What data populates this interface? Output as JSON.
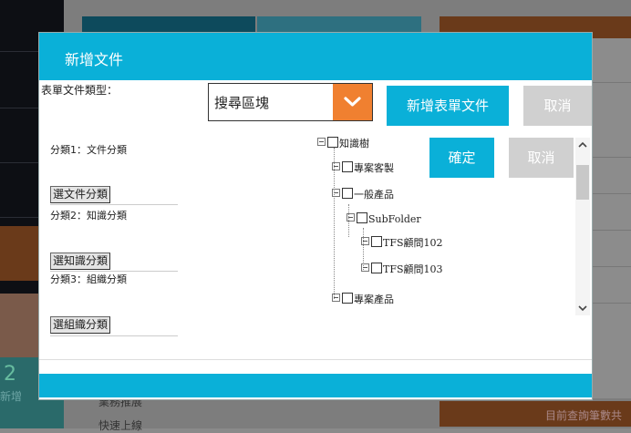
{
  "background": {
    "new_count": "2",
    "new_label": "新增",
    "tree_item_1": "業務推展",
    "tree_item_2": "快速上線",
    "result_count": "目前查詢筆數共"
  },
  "modal": {
    "title": "新增文件",
    "doc_type_label": "表單文件類型：",
    "doc_type_value": "搜尋區塊",
    "new_form_button": "新增表單文件",
    "cancel_top_button": "取消",
    "ok_button": "確定",
    "cancel_button": "取消"
  },
  "categories": [
    {
      "label": "分類1：文件分類",
      "button": "選文件分類"
    },
    {
      "label": "分類2：知識分類",
      "button": "選知識分類"
    },
    {
      "label": "分類3：組織分類",
      "button": "選組織分類"
    }
  ],
  "tree": [
    {
      "label": "知識樹",
      "level": 0
    },
    {
      "label": "專案客製",
      "level": 1
    },
    {
      "label": "一般產品",
      "level": 1
    },
    {
      "label": "SubFolder",
      "level": 2
    },
    {
      "label": "TFS顧問102",
      "level": 3
    },
    {
      "label": "TFS顧問103",
      "level": 3
    },
    {
      "label": "專案產品",
      "level": 1
    }
  ],
  "colors": {
    "accent": "#0ab0d8",
    "dropdown_arrow": "#f08030",
    "disabled_button": "#d0d0d0"
  }
}
